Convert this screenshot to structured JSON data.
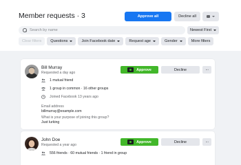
{
  "header": {
    "title": "Member requests · 3",
    "approve_all": "Approve all",
    "decline_all": "Decline all"
  },
  "search": {
    "placeholder": "Search by name"
  },
  "sort": {
    "label": "Newest First"
  },
  "filters": [
    {
      "label": "Clear filters",
      "enabled": false
    },
    {
      "label": "Questions"
    },
    {
      "label": "Join Facebook date"
    },
    {
      "label": "Request age"
    },
    {
      "label": "Gender"
    },
    {
      "label": "More filters"
    }
  ],
  "requests": [
    {
      "name": "Bill Murray",
      "requested": "Requested a day ago",
      "mutual_friends": "1 mutual friend",
      "groups": "1 group in common · 16 other groups",
      "joined": "Joined Facebook 13 years ago",
      "email_label": "Email address",
      "email": "billmurray@example.com",
      "question": "What is your purpose of joining this group?",
      "answer": "Just lurking",
      "approve": "Approve",
      "decline": "Decline",
      "more": "···"
    },
    {
      "name": "John Doe",
      "requested": "Requested a year ago",
      "friends": "556 friends · 60 mutual friends · 1 friend in group",
      "approve": "Approve",
      "decline": "Decline",
      "more": "···"
    }
  ],
  "colors": {
    "primary": "#1877f2",
    "approve": "#42b72a",
    "secondary_button": "#e4e6eb",
    "background": "#f0f2f5"
  }
}
